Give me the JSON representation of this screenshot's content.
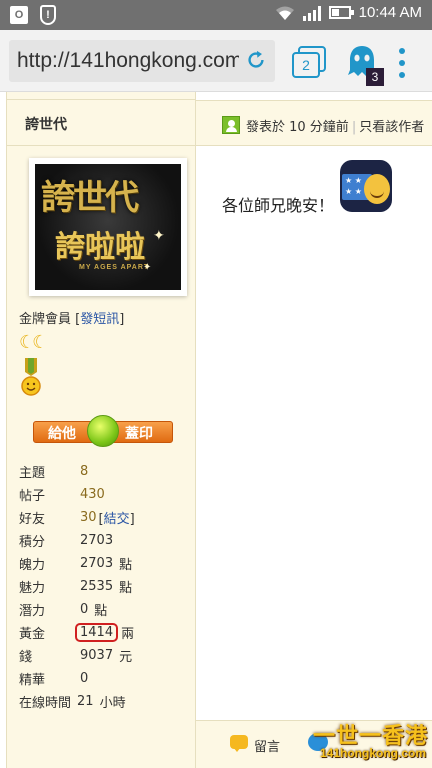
{
  "status_bar": {
    "time": "10:44 AM",
    "left_icons": [
      "outlook-icon",
      "shield-alert-icon"
    ],
    "right_icons": [
      "wifi-icon",
      "signal-icon",
      "battery-icon"
    ],
    "outlook_glyph": "O",
    "shield_glyph": "!"
  },
  "browser": {
    "url": "http://141hongkong.com",
    "tab_count": "2",
    "ghost_badge": "3",
    "accent": "#2196c9"
  },
  "author": {
    "name": "誇世代",
    "avatar": {
      "line1": "誇世代",
      "line2": "誇啦啦",
      "line3": "MY AGES APART"
    },
    "rank": "金牌會員",
    "send_message_link": "發短訊",
    "moons": "☾☾",
    "give_button": {
      "left": "給他",
      "right": "蓋印"
    },
    "stats": [
      {
        "key": "主題",
        "value": "8",
        "suffix": "",
        "link": true
      },
      {
        "key": "帖子",
        "value": "430",
        "suffix": "",
        "link": true
      },
      {
        "key": "好友",
        "value": "30",
        "suffix": "",
        "link": true,
        "extra_link": "結交"
      },
      {
        "key": "積分",
        "value": "2703",
        "suffix": ""
      },
      {
        "key": "魄力",
        "value": "2703",
        "suffix": "點"
      },
      {
        "key": "魅力",
        "value": "2535",
        "suffix": "點"
      },
      {
        "key": "潛力",
        "value": "0",
        "suffix": "點"
      },
      {
        "key": "黃金",
        "value": "1414",
        "suffix": "兩",
        "highlight": true
      },
      {
        "key": "錢",
        "value": "9037",
        "suffix": "元"
      },
      {
        "key": "精華",
        "value": "0",
        "suffix": ""
      },
      {
        "key": "在線時間",
        "value": "21",
        "suffix": "小時"
      }
    ]
  },
  "post": {
    "posted": "發表於 10 分鐘前",
    "author_only": "只看該作者",
    "separator": "|",
    "body": "各位師兄晚安！",
    "reply_label": "留言"
  },
  "watermark": {
    "main": "一世一香港",
    "sub": "141hongkong.com"
  },
  "colors": {
    "panel_bg": "#fdf8e4",
    "link": "#2a55a5",
    "stat_link": "#8a6b1e",
    "highlight_border": "#d02020",
    "status_bar": "#707070"
  }
}
